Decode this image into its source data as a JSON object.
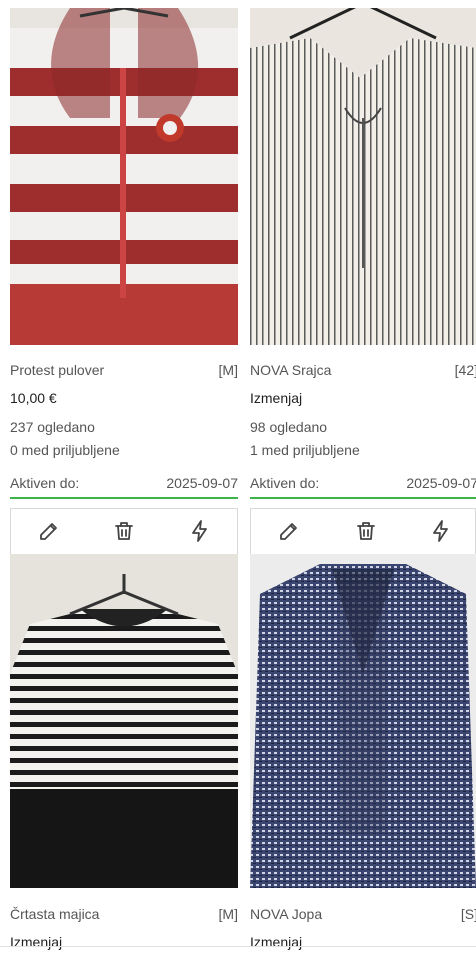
{
  "listings": [
    {
      "name": "Protest pulover",
      "size": "[M]",
      "price": "10,00 €",
      "views": "237 ogledano",
      "favorites": "0 med priljubljene",
      "active_label": "Aktiven do:",
      "active_date": "2025-09-07"
    },
    {
      "name": "NOVA Srajca",
      "size": "[42]",
      "price": "Izmenjaj",
      "views": "98 ogledano",
      "favorites": "1 med priljubljene",
      "active_label": "Aktiven do:",
      "active_date": "2025-09-07"
    },
    {
      "name": "Črtasta majica",
      "size": "[M]",
      "price": "Izmenjaj"
    },
    {
      "name": "NOVA Jopa",
      "size": "[S]",
      "price": "Izmenjaj"
    }
  ],
  "actions": {
    "edit_icon": "pencil-icon",
    "delete_icon": "trash-icon",
    "promote_icon": "lightning-icon"
  },
  "colors": {
    "active_underline": "#3cb44b"
  }
}
